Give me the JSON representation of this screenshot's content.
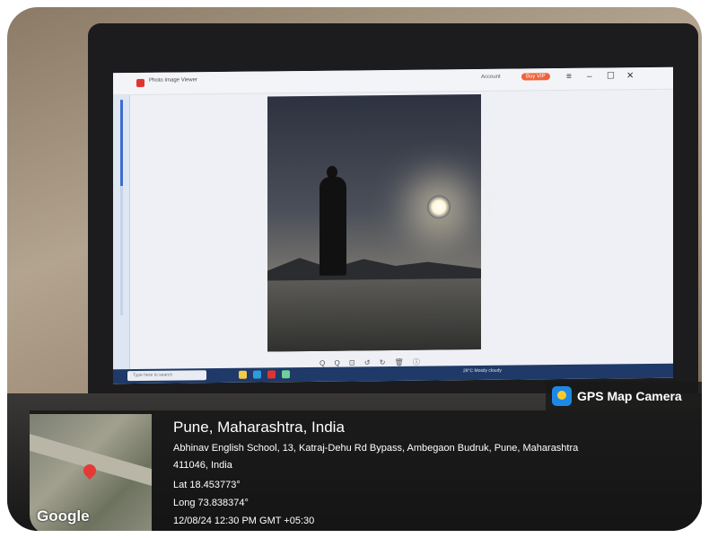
{
  "screen": {
    "app_title": "Photo Image Viewer",
    "account_label": "Account",
    "buy_label": "Buy VIP",
    "search_placeholder": "Type here to search",
    "weather": "28°C Mostly cloudy",
    "viewer_tools": "Q Q ⊡ ↺ ↻ 🗑 ⓘ"
  },
  "gps_badge": {
    "label": "GPS Map Camera"
  },
  "location": {
    "city": "Pune, Maharashtra, India",
    "address_line1": "Abhinav English School, 13, Katraj-Dehu Rd Bypass, Ambegaon Budruk, Pune, Maharashtra",
    "address_line2": "411046, India",
    "lat": "Lat 18.453773°",
    "long": "Long 73.838374°",
    "timestamp": "12/08/24 12:30 PM GMT +05:30",
    "map_brand": "Google"
  },
  "colors": {
    "buy_button": "#f0623a",
    "gps_icon": "#1e88e5",
    "map_pin": "#e53935"
  }
}
